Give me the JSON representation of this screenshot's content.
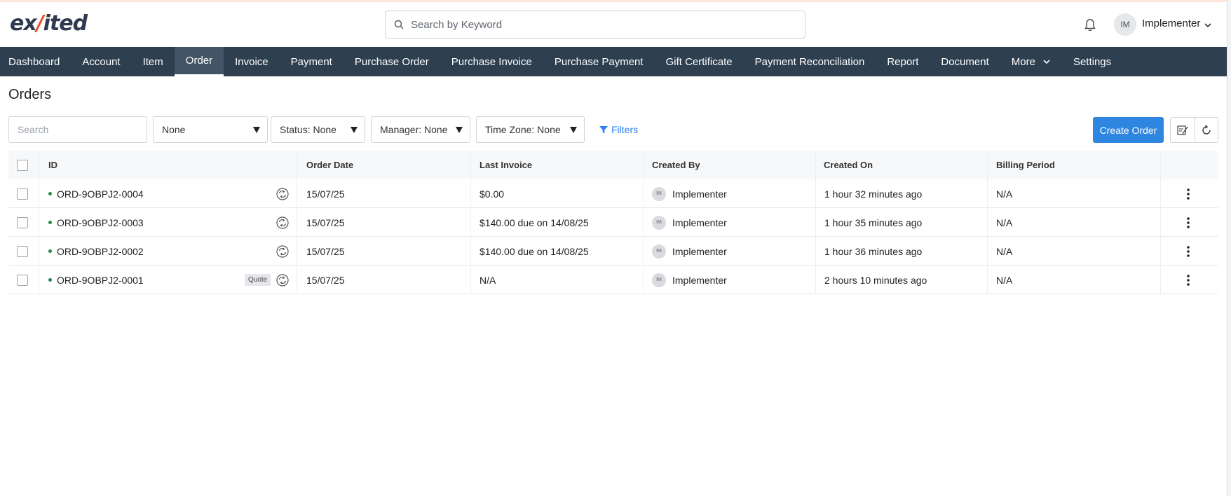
{
  "header": {
    "logo_text_a": "ex",
    "logo_text_b": "ited",
    "search_placeholder": "Search by Keyword",
    "user_initials": "IM",
    "user_name": "Implementer"
  },
  "nav": {
    "items": [
      "Dashboard",
      "Account",
      "Item",
      "Order",
      "Invoice",
      "Payment",
      "Purchase Order",
      "Purchase Invoice",
      "Purchase Payment",
      "Gift Certificate",
      "Payment Reconciliation",
      "Report",
      "Document",
      "More",
      "Settings"
    ],
    "active": "Order"
  },
  "page": {
    "title": "Orders"
  },
  "filters": {
    "search_placeholder": "Search",
    "view_select": "None",
    "status_select": "Status: None",
    "manager_select": "Manager: None",
    "timezone_select": "Time Zone: None",
    "filters_link": "Filters",
    "create_button": "Create Order"
  },
  "table": {
    "columns": [
      "ID",
      "Order Date",
      "Last Invoice",
      "Created By",
      "Created On",
      "Billing Period"
    ],
    "rows": [
      {
        "id": "ORD-9OBPJ2-0004",
        "badge": "",
        "order_date": "15/07/25",
        "last_invoice": "$0.00",
        "created_by_initials": "IM",
        "created_by": "Implementer",
        "created_on": "1 hour 32 minutes ago",
        "billing_period": "N/A"
      },
      {
        "id": "ORD-9OBPJ2-0003",
        "badge": "",
        "order_date": "15/07/25",
        "last_invoice": "$140.00 due on 14/08/25",
        "created_by_initials": "IM",
        "created_by": "Implementer",
        "created_on": "1 hour 35 minutes ago",
        "billing_period": "N/A"
      },
      {
        "id": "ORD-9OBPJ2-0002",
        "badge": "",
        "order_date": "15/07/25",
        "last_invoice": "$140.00 due on 14/08/25",
        "created_by_initials": "IM",
        "created_by": "Implementer",
        "created_on": "1 hour 36 minutes ago",
        "billing_period": "N/A"
      },
      {
        "id": "ORD-9OBPJ2-0001",
        "badge": "Quote",
        "order_date": "15/07/25",
        "last_invoice": "N/A",
        "created_by_initials": "IM",
        "created_by": "Implementer",
        "created_on": "2 hours 10 minutes ago",
        "billing_period": "N/A"
      }
    ]
  },
  "colors": {
    "nav_bg": "#2e3f50",
    "accent": "#2f86e0",
    "status_dot": "#1f8a4c",
    "logo_accent": "#e8552b"
  }
}
